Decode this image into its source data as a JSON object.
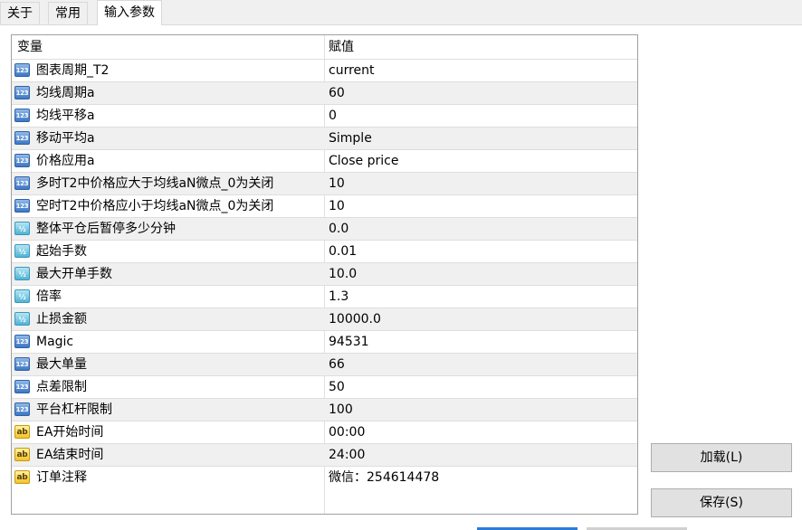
{
  "tabs": [
    {
      "label": "关于"
    },
    {
      "label": "常用"
    },
    {
      "label": "输入参数"
    }
  ],
  "table": {
    "headers": {
      "variable": "变量",
      "value": "赋值"
    },
    "rows": [
      {
        "icon": "integer-icon",
        "icon_text": "123",
        "name": "图表周期_T2",
        "value": "current"
      },
      {
        "icon": "integer-icon",
        "icon_text": "123",
        "name": "均线周期a",
        "value": "60"
      },
      {
        "icon": "integer-icon",
        "icon_text": "123",
        "name": "均线平移a",
        "value": "0"
      },
      {
        "icon": "integer-icon",
        "icon_text": "123",
        "name": "移动平均a",
        "value": "Simple"
      },
      {
        "icon": "integer-icon",
        "icon_text": "123",
        "name": "价格应用a",
        "value": "Close price"
      },
      {
        "icon": "integer-icon",
        "icon_text": "123",
        "name": "多时T2中价格应大于均线aN微点_0为关闭",
        "value": "10"
      },
      {
        "icon": "integer-icon",
        "icon_text": "123",
        "name": "空时T2中价格应小于均线aN微点_0为关闭",
        "value": "10"
      },
      {
        "icon": "double-icon",
        "icon_text": "½",
        "name": "整体平仓后暂停多少分钟",
        "value": "0.0"
      },
      {
        "icon": "double-icon",
        "icon_text": "½",
        "name": "起始手数",
        "value": "0.01"
      },
      {
        "icon": "double-icon",
        "icon_text": "½",
        "name": "最大开单手数",
        "value": "10.0"
      },
      {
        "icon": "double-icon",
        "icon_text": "½",
        "name": "倍率",
        "value": "1.3"
      },
      {
        "icon": "double-icon",
        "icon_text": "½",
        "name": "止损金额",
        "value": "10000.0"
      },
      {
        "icon": "integer-icon",
        "icon_text": "123",
        "name": "Magic",
        "value": "94531"
      },
      {
        "icon": "integer-icon",
        "icon_text": "123",
        "name": "最大单量",
        "value": "66"
      },
      {
        "icon": "integer-icon",
        "icon_text": "123",
        "name": "点差限制",
        "value": "50"
      },
      {
        "icon": "integer-icon",
        "icon_text": "123",
        "name": "平台杠杆限制",
        "value": "100"
      },
      {
        "icon": "string-icon",
        "icon_text": "ab",
        "name": "EA开始时间",
        "value": "00:00"
      },
      {
        "icon": "string-icon",
        "icon_text": "ab",
        "name": "EA结束时间",
        "value": "24:00"
      },
      {
        "icon": "string-icon",
        "icon_text": "ab",
        "name": "订单注释",
        "value": "微信：254614478"
      }
    ]
  },
  "buttons": {
    "load_label": "加载(L)",
    "save_label": "保存(S)"
  }
}
